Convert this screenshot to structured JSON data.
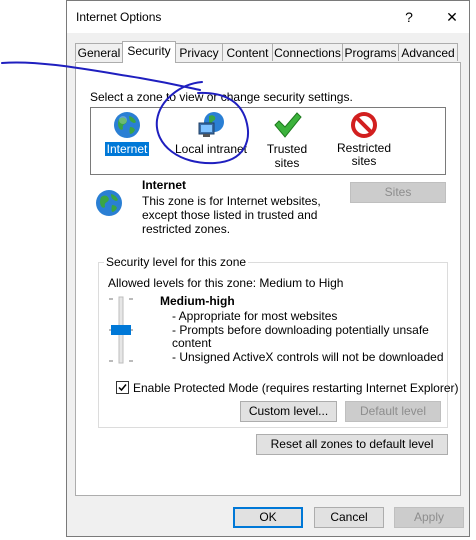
{
  "window": {
    "title": "Internet Options",
    "help_glyph": "?",
    "close_glyph": "✕"
  },
  "tabs": [
    {
      "label": "General"
    },
    {
      "label": "Security",
      "active": true
    },
    {
      "label": "Privacy"
    },
    {
      "label": "Content"
    },
    {
      "label": "Connections"
    },
    {
      "label": "Programs"
    },
    {
      "label": "Advanced"
    }
  ],
  "zones": {
    "instruction": "Select a zone to view or change security settings.",
    "items": [
      {
        "label": "Internet",
        "icon": "globe-icon",
        "selected": true
      },
      {
        "label": "Local intranet",
        "icon": "intranet-computer-icon"
      },
      {
        "label": "Trusted sites",
        "icon": "green-checkmark-icon"
      },
      {
        "label_line1": "Restricted",
        "label_line2": "sites",
        "icon": "no-entry-icon"
      }
    ]
  },
  "zone_info": {
    "title": "Internet",
    "description_lines": [
      "This zone is for Internet websites,",
      "except those listed in trusted and",
      "restricted zones."
    ],
    "sites_button": "Sites"
  },
  "security_level": {
    "group_label": "Security level for this zone",
    "allowed": "Allowed levels for this zone: Medium to High",
    "level_name": "Medium-high",
    "details": [
      "- Appropriate for most websites",
      "- Prompts before downloading potentially unsafe",
      "content",
      "- Unsigned ActiveX controls will not be downloaded"
    ],
    "protected_mode_label": "Enable Protected Mode (requires restarting Internet Explorer)",
    "protected_mode_checked": true,
    "custom_level_button": "Custom level...",
    "default_level_button": "Default level"
  },
  "reset_button": "Reset all zones to default level",
  "footer": {
    "ok": "OK",
    "cancel": "Cancel",
    "apply": "Apply"
  },
  "colors": {
    "accent": "#0078d7",
    "annotation_ink": "#1f1fbf"
  }
}
